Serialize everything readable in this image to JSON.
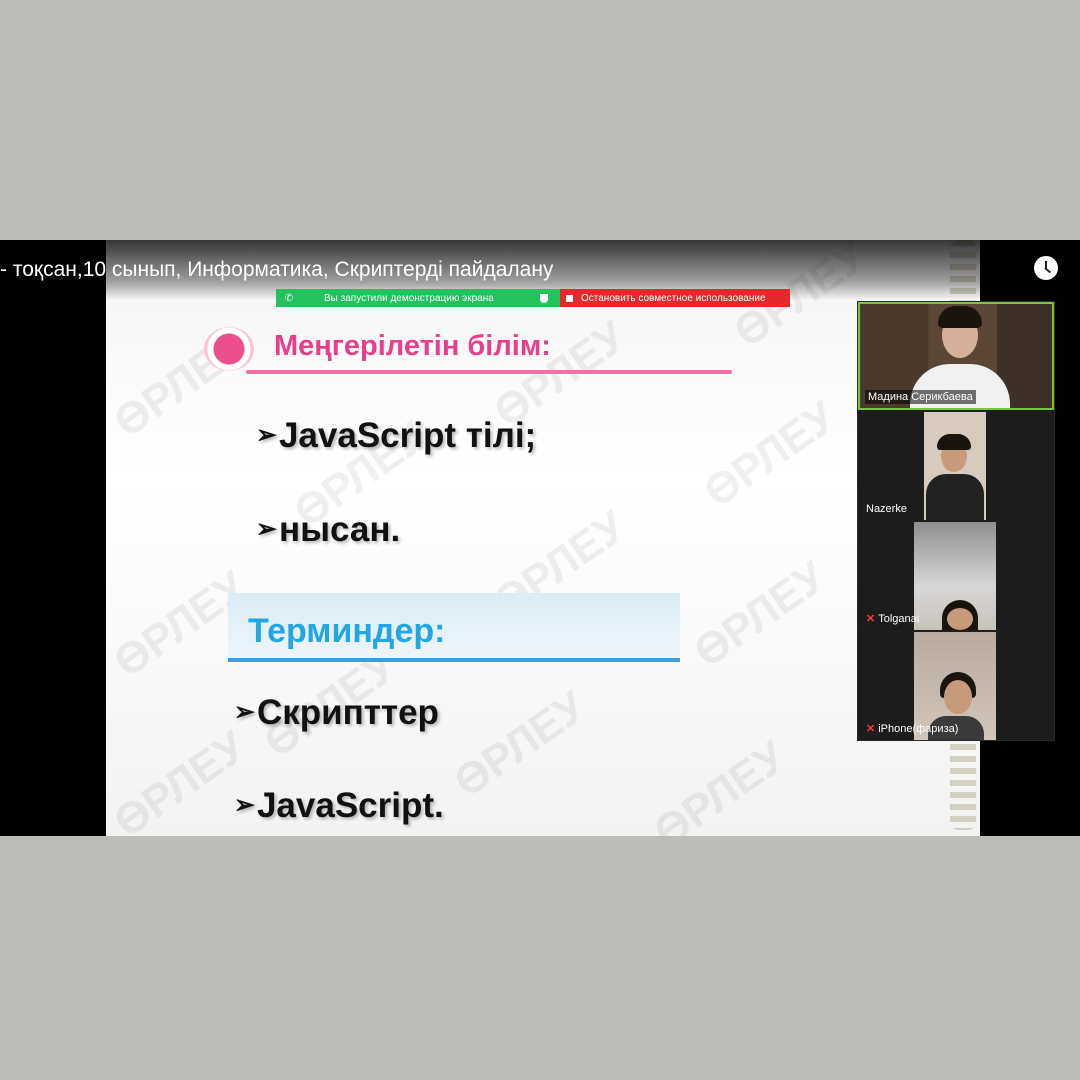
{
  "window": {
    "video_title": "- тоқсан,10 сынып, Информатика, Скриптерді пайдалану",
    "clock_icon": "clock-icon"
  },
  "share_bar": {
    "status_label": "Вы запустили демонстрацию экрана",
    "stop_label": "Остановить совместное использование",
    "status_color": "#22c25c",
    "stop_color": "#e5282c"
  },
  "slide": {
    "heading": "Меңгерілетін білім:",
    "bullets": [
      "JavaScript  тілі;",
      "нысан."
    ],
    "terms_heading": "Терминдер:",
    "terms": [
      "Скрипттер",
      "JavaScript."
    ],
    "watermark": "ӨРЛЕУ",
    "bullet_glyph": "➢",
    "accent_pink": "#e73f8c",
    "accent_blue": "#22a6e4"
  },
  "participants": [
    {
      "name": "Мадина Серикбаева",
      "muted": false,
      "active_speaker": true
    },
    {
      "name": "Nazerke",
      "muted": false,
      "active_speaker": false
    },
    {
      "name": "Tolganai",
      "muted": true,
      "active_speaker": false
    },
    {
      "name": "iPhone(фариза)",
      "muted": true,
      "active_speaker": false
    }
  ]
}
